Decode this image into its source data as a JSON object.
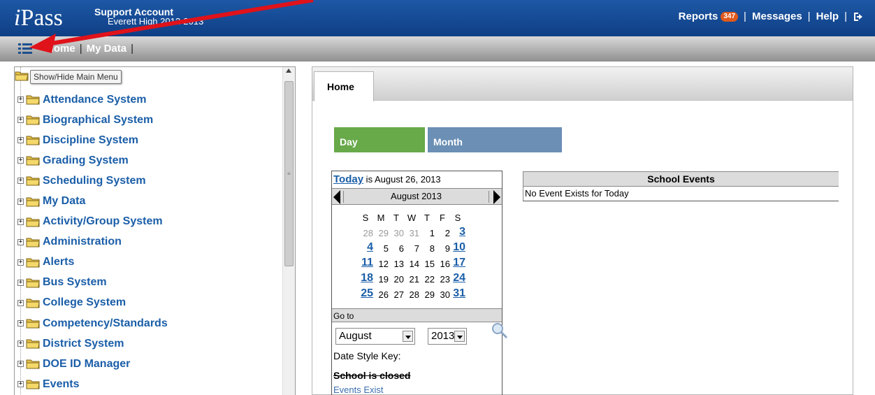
{
  "header": {
    "logo_i": "i",
    "logo_rest": "Pass",
    "account_name": "Support Account",
    "account_school": "Everett High",
    "account_year": "2012-2013",
    "links": {
      "reports": "Reports",
      "reports_badge": "347",
      "separator": "|",
      "messages": "Messages",
      "help": "Help"
    }
  },
  "nav": {
    "home": "Home",
    "my_data": "My Data",
    "separator": "|"
  },
  "left_menu": {
    "tooltip": "Show/Hide Main Menu",
    "items": [
      "Attendance System",
      "Biographical System",
      "Discipline System",
      "Grading System",
      "Scheduling System",
      "My Data",
      "Activity/Group System",
      "Administration",
      "Alerts",
      "Bus System",
      "College System",
      "Competency/Standards",
      "District System",
      "DOE ID Manager",
      "Events"
    ]
  },
  "content": {
    "tab_home": "Home",
    "btn_day": "Day",
    "btn_month": "Month",
    "calendar": {
      "today_link": "Today",
      "today_text": " is August 26, 2013",
      "month_title": "August 2013",
      "weekdays": [
        "S",
        "M",
        "T",
        "W",
        "T",
        "F",
        "S"
      ],
      "weeks": [
        [
          "28",
          "29",
          "30",
          "31",
          "1",
          "2",
          "3"
        ],
        [
          "4",
          "5",
          "6",
          "7",
          "8",
          "9",
          "10"
        ],
        [
          "11",
          "12",
          "13",
          "14",
          "15",
          "16",
          "17"
        ],
        [
          "18",
          "19",
          "20",
          "21",
          "22",
          "23",
          "24"
        ],
        [
          "25",
          "26",
          "27",
          "28",
          "29",
          "30",
          "31"
        ]
      ],
      "goto_label": "Go to",
      "month_select": "August",
      "year_select": "2013",
      "style_key": "Date Style Key:",
      "closed": "School is closed",
      "events_exist": "Events Exist"
    },
    "events": {
      "header": "School Events",
      "message": "No Event Exists for Today"
    }
  },
  "colors": {
    "header_blue": "#1d58a6",
    "link_blue": "#1a5ea8",
    "day_green": "#68a94a",
    "month_blue": "#6b8fb5",
    "badge_orange": "#e0591c",
    "annotation_red": "#e0121a"
  },
  "icons": [
    "menu-list-icon",
    "folder-icon",
    "plus-expand-icon",
    "magnifier-icon",
    "logout-icon"
  ]
}
